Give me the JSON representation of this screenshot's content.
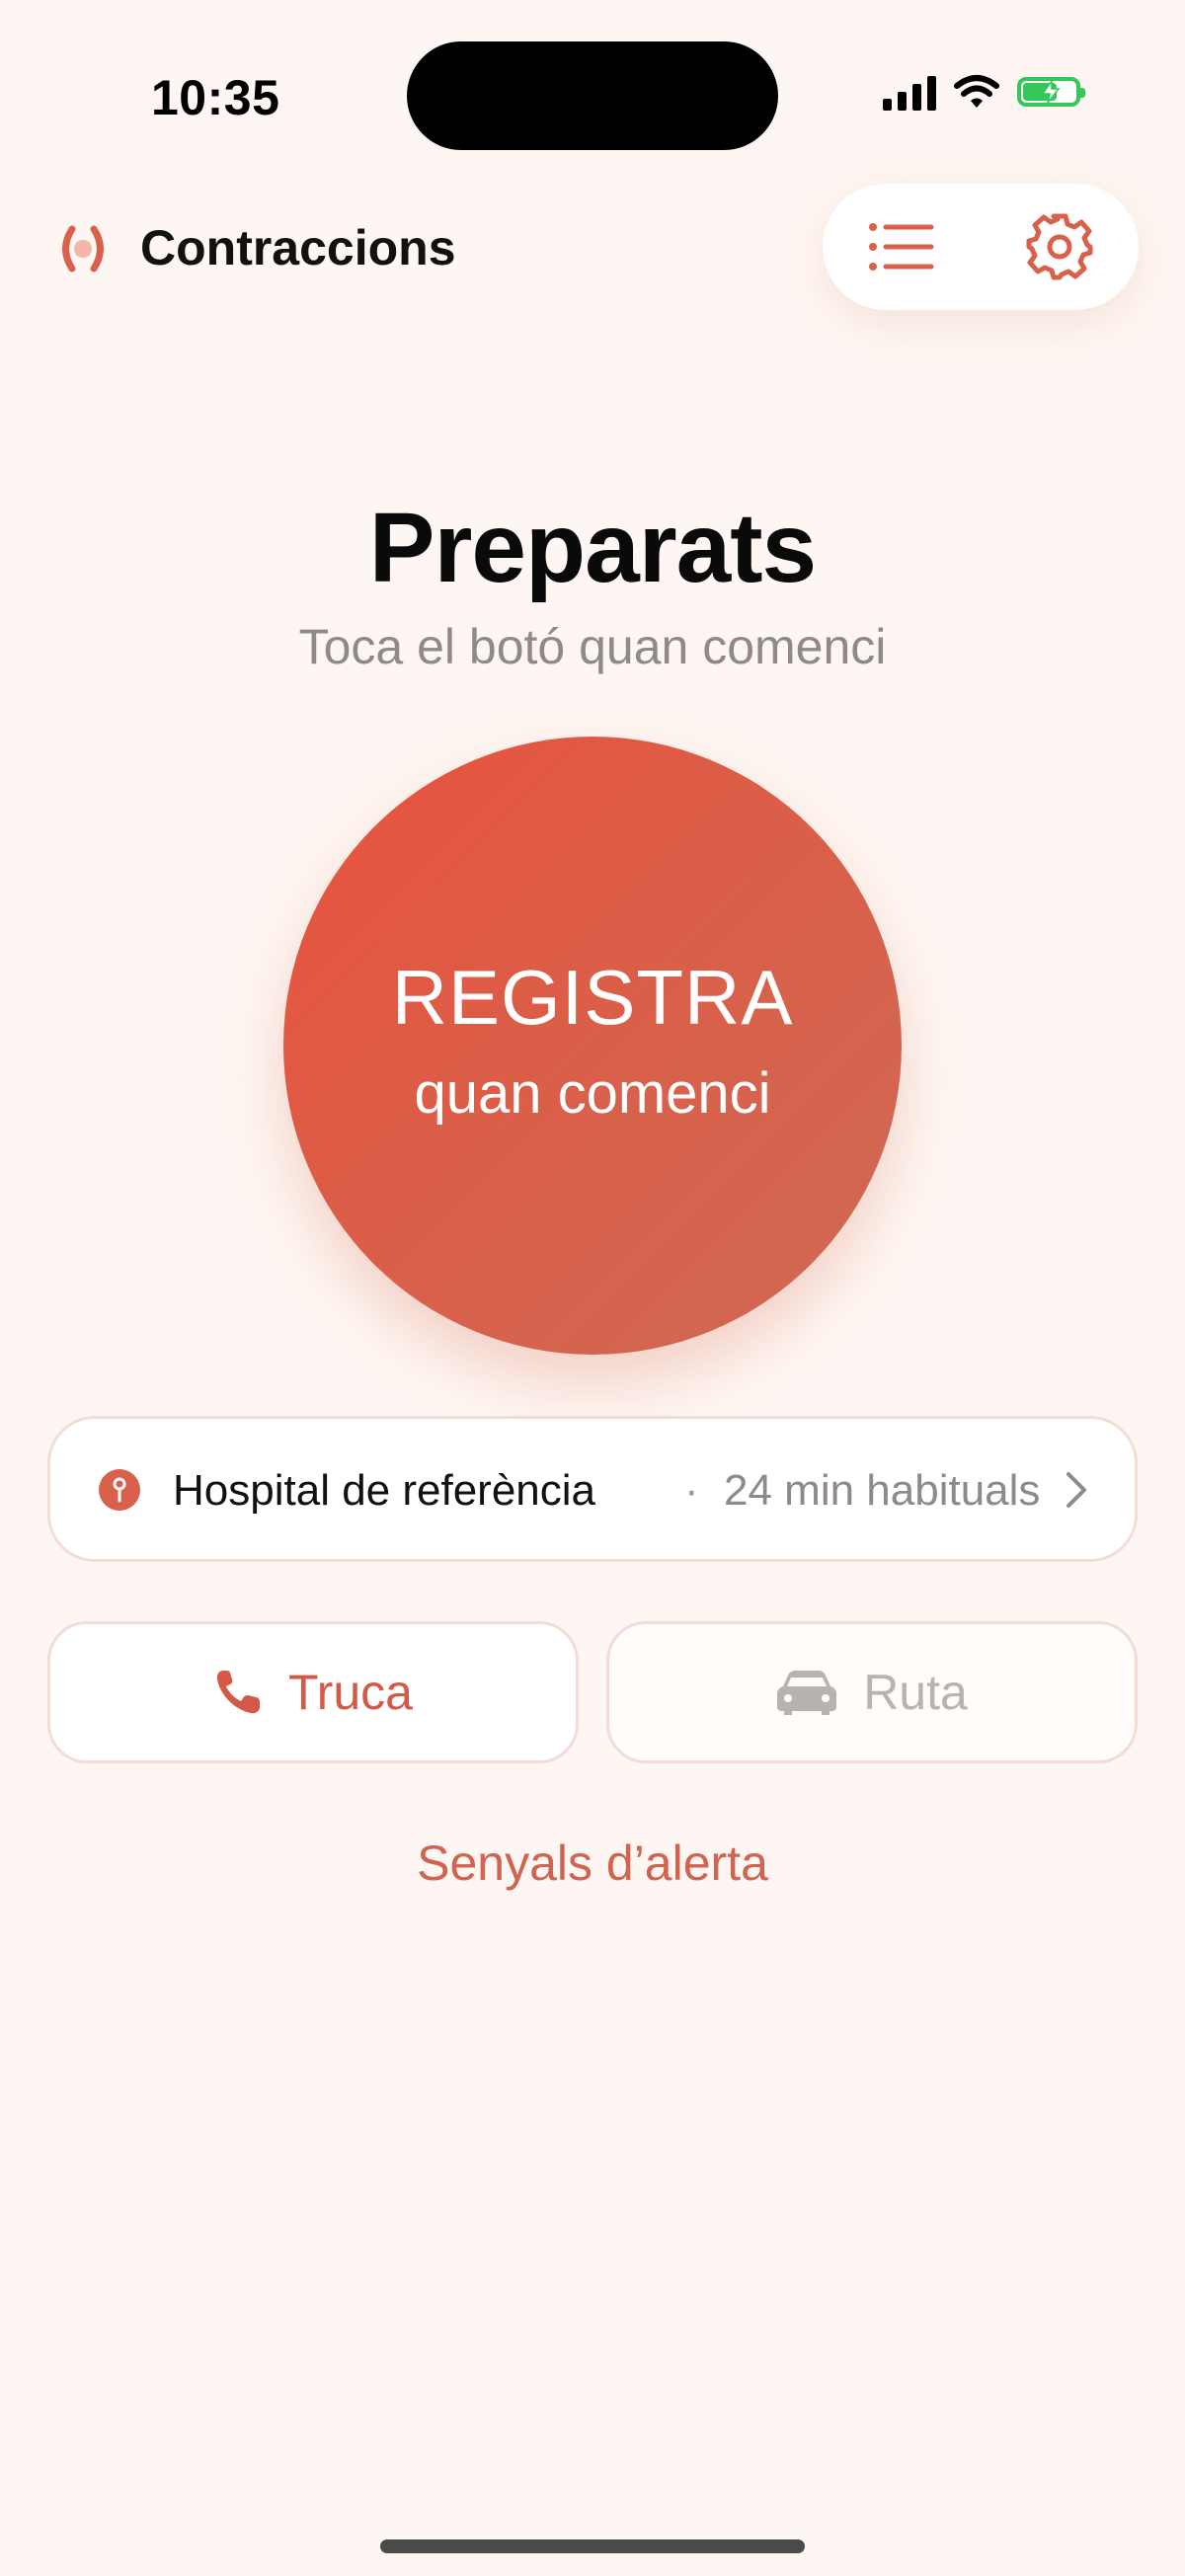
{
  "status_bar": {
    "time": "10:35",
    "battery_color": "#34C759"
  },
  "header": {
    "title": "Contraccions",
    "logo_icon": "contraction-wave-icon",
    "list_icon": "list-icon",
    "settings_icon": "gear-icon"
  },
  "main": {
    "title": "Preparats",
    "subtitle": "Toca el botó quan comenci",
    "register_button": {
      "label": "REGISTRA",
      "sublabel": "quan comenci"
    }
  },
  "hospital": {
    "icon": "location-pin-icon",
    "name": "Hospital de referència",
    "separator": "·",
    "travel_time": "24 min habituals"
  },
  "actions": {
    "call": {
      "label": "Truca",
      "icon": "phone-icon"
    },
    "route": {
      "label": "Ruta",
      "icon": "car-icon"
    }
  },
  "alert_link": "Senyals d’alerta",
  "colors": {
    "accent": "#D9604A",
    "background": "#FEF6F2"
  }
}
